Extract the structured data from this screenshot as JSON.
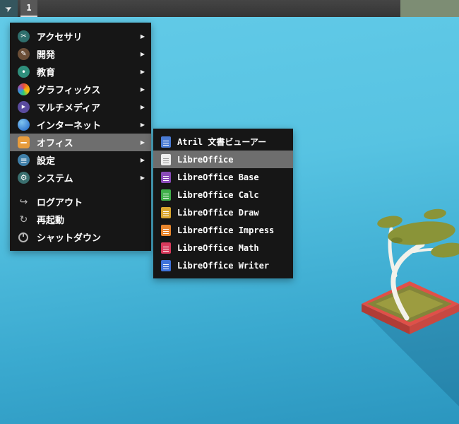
{
  "topbar": {
    "workspace_label": "1"
  },
  "menu": {
    "arrow": "▶",
    "items": [
      {
        "label": "アクセサリ",
        "icon": "accessories-icon",
        "has_submenu": true
      },
      {
        "label": "開発",
        "icon": "development-icon",
        "has_submenu": true
      },
      {
        "label": "教育",
        "icon": "education-icon",
        "has_submenu": true
      },
      {
        "label": "グラフィックス",
        "icon": "graphics-icon",
        "has_submenu": true
      },
      {
        "label": "マルチメディア",
        "icon": "multimedia-icon",
        "has_submenu": true
      },
      {
        "label": "インターネット",
        "icon": "internet-icon",
        "has_submenu": true
      },
      {
        "label": "オフィス",
        "icon": "office-icon",
        "has_submenu": true,
        "highlighted": true
      },
      {
        "label": "設定",
        "icon": "settings-icon",
        "has_submenu": true
      },
      {
        "label": "システム",
        "icon": "system-icon",
        "has_submenu": true
      },
      {
        "label": "ログアウト",
        "icon": "logout-icon",
        "has_submenu": false
      },
      {
        "label": "再起動",
        "icon": "reboot-icon",
        "has_submenu": false
      },
      {
        "label": "シャットダウン",
        "icon": "shutdown-icon",
        "has_submenu": false
      }
    ]
  },
  "submenu": {
    "items": [
      {
        "label": "Atril 文書ビューアー",
        "icon": "atril-icon"
      },
      {
        "label": "LibreOffice",
        "icon": "libreoffice-icon",
        "highlighted": true
      },
      {
        "label": "LibreOffice Base",
        "icon": "libreoffice-base-icon"
      },
      {
        "label": "LibreOffice Calc",
        "icon": "libreoffice-calc-icon"
      },
      {
        "label": "LibreOffice Draw",
        "icon": "libreoffice-draw-icon"
      },
      {
        "label": "LibreOffice Impress",
        "icon": "libreoffice-impress-icon"
      },
      {
        "label": "LibreOffice Math",
        "icon": "libreoffice-math-icon"
      },
      {
        "label": "LibreOffice Writer",
        "icon": "libreoffice-writer-icon"
      }
    ]
  },
  "colors": {
    "wallpaper_top": "#63cbe8",
    "wallpaper_bottom": "#2b96bf",
    "panel_bg": "#3c3c3c",
    "panel_status_green": "#7d8d74",
    "menu_bg": "#161616",
    "menu_highlight": "#6e6e6e",
    "menu_text": "#ffffff",
    "bonsai_foliage": "#8a9438",
    "bonsai_pot_red": "#e05048",
    "bonsai_trunk": "#f2f1ea"
  }
}
